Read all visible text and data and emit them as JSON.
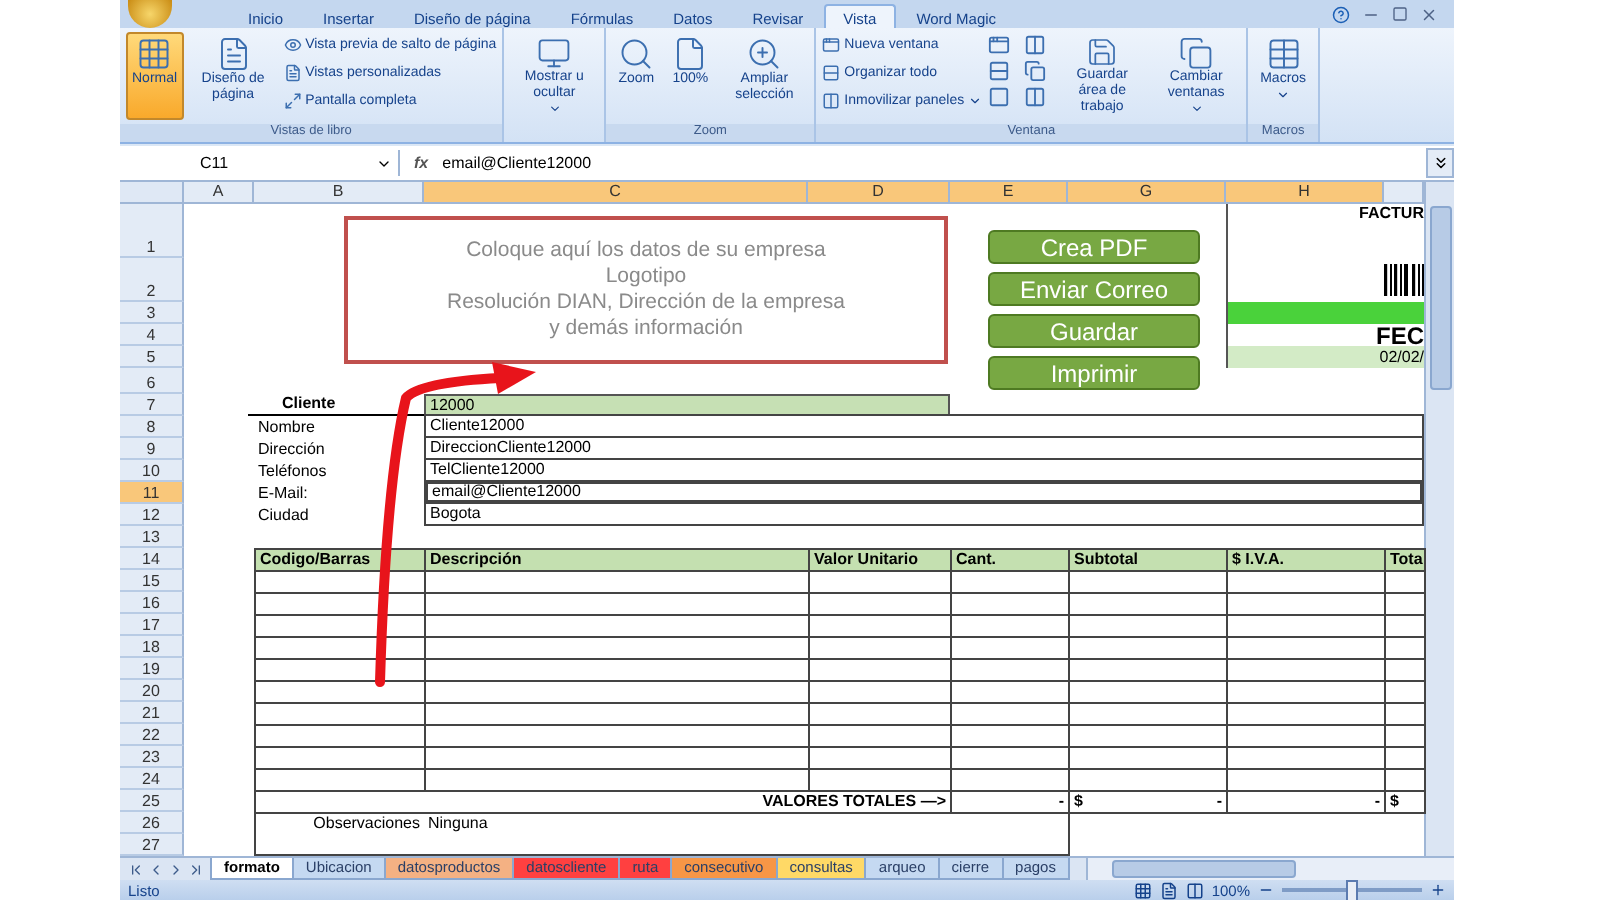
{
  "ribbon_tabs": [
    {
      "label": "Inicio",
      "selected": false
    },
    {
      "label": "Insertar",
      "selected": false
    },
    {
      "label": "Diseño de página",
      "selected": false
    },
    {
      "label": "Fórmulas",
      "selected": false
    },
    {
      "label": "Datos",
      "selected": false
    },
    {
      "label": "Revisar",
      "selected": false
    },
    {
      "label": "Vista",
      "selected": true
    },
    {
      "label": "Word Magic",
      "selected": false
    }
  ],
  "ribbon_groups": [
    {
      "label": "Vistas de libro",
      "items": [
        {
          "kind": "large",
          "label": "Normal",
          "selected": true,
          "dropdown": false
        },
        {
          "kind": "large",
          "label": "Diseño de página",
          "selected": false,
          "dropdown": false
        },
        {
          "kind": "small",
          "labels": [
            "Vista previa de salto de página",
            "Vistas personalizadas",
            "Pantalla completa"
          ]
        }
      ]
    },
    {
      "items": [
        {
          "kind": "large",
          "label": "Mostrar u ocultar",
          "selected": false,
          "dropdown": true
        }
      ]
    },
    {
      "label": "Zoom",
      "items": [
        {
          "kind": "large",
          "label": "Zoom",
          "selected": false,
          "dropdown": false
        },
        {
          "kind": "large",
          "label": "100%",
          "selected": false,
          "dropdown": false
        },
        {
          "kind": "large",
          "label": "Ampliar selección",
          "selected": false,
          "dropdown": false
        }
      ]
    },
    {
      "label": "Ventana",
      "items": [
        {
          "kind": "small",
          "labels": [
            "Nueva ventana",
            "Organizar todo",
            "Inmovilizar paneles"
          ],
          "dropdown_last": true
        },
        {
          "kind": "icon_grid"
        },
        {
          "kind": "large",
          "label": "Guardar área de trabajo",
          "selected": false,
          "dropdown": false
        },
        {
          "kind": "large",
          "label": "Cambiar ventanas",
          "selected": false,
          "dropdown": true
        }
      ]
    },
    {
      "label": "Macros",
      "items": [
        {
          "kind": "large",
          "label": "Macros",
          "selected": false,
          "dropdown": true
        }
      ]
    }
  ],
  "formula_bar": {
    "name_box": "C11",
    "fx_label": "fx",
    "value": "email@Cliente12000"
  },
  "columns": [
    {
      "label": "A",
      "selected": false
    },
    {
      "label": "B",
      "selected": false
    },
    {
      "label": "C",
      "selected": true
    },
    {
      "label": "D",
      "selected": true
    },
    {
      "label": "E",
      "selected": true
    },
    {
      "label": "G",
      "selected": true
    },
    {
      "label": "H",
      "selected": true
    }
  ],
  "rows": [
    {
      "label": "1",
      "selected": false
    },
    {
      "label": "2",
      "selected": false
    },
    {
      "label": "3",
      "selected": false
    },
    {
      "label": "4",
      "selected": false
    },
    {
      "label": "5",
      "selected": false
    },
    {
      "label": "6",
      "selected": false
    },
    {
      "label": "7",
      "selected": false
    },
    {
      "label": "8",
      "selected": false
    },
    {
      "label": "9",
      "selected": false
    },
    {
      "label": "10",
      "selected": false
    },
    {
      "label": "11",
      "selected": true
    },
    {
      "label": "12",
      "selected": false
    },
    {
      "label": "13",
      "selected": false
    },
    {
      "label": "14",
      "selected": false
    },
    {
      "label": "15",
      "selected": false
    },
    {
      "label": "16",
      "selected": false
    },
    {
      "label": "17",
      "selected": false
    },
    {
      "label": "18",
      "selected": false
    },
    {
      "label": "19",
      "selected": false
    },
    {
      "label": "20",
      "selected": false
    },
    {
      "label": "21",
      "selected": false
    },
    {
      "label": "22",
      "selected": false
    },
    {
      "label": "23",
      "selected": false
    },
    {
      "label": "24",
      "selected": false
    },
    {
      "label": "25",
      "selected": false
    },
    {
      "label": "26",
      "selected": false
    },
    {
      "label": "27",
      "selected": false
    }
  ],
  "company_box": {
    "lines": [
      "Coloque aquí los datos de su empresa",
      "Logotipo",
      "Resolución DIAN, Dirección de la empresa",
      "y demás información"
    ]
  },
  "action_buttons": [
    "Crea PDF",
    "Enviar Correo",
    "Guardar",
    "Imprimir"
  ],
  "invoice_header": {
    "title": "FACTUR",
    "date_label": "FEC",
    "date": "02/02/"
  },
  "client": {
    "label": "Cliente",
    "value": "12000",
    "fields": [
      {
        "label": "Nombre",
        "value": "Cliente12000"
      },
      {
        "label": "Dirección",
        "value": "DireccionCliente12000"
      },
      {
        "label": "Teléfonos",
        "value": "TelCliente12000"
      },
      {
        "label": "E-Mail:",
        "value": "email@Cliente12000"
      },
      {
        "label": "Ciudad",
        "value": "Bogota"
      }
    ]
  },
  "table": {
    "columns": [
      "Codigo/Barras",
      "Descripción",
      "Valor Unitario",
      "Cant.",
      "Subtotal",
      "$ I.V.A.",
      "Tota"
    ],
    "totals": {
      "label": "VALORES TOTALES —>",
      "cells": [
        {
          "text": "-"
        },
        {
          "currency": "$",
          "text": "-"
        },
        {
          "text": "-"
        },
        {
          "currency": "$"
        }
      ]
    }
  },
  "observations": {
    "label": "Observaciones",
    "value": "Ninguna"
  },
  "sheet_tabs": [
    {
      "label": "formato",
      "selected": true,
      "color": "#ffffff"
    },
    {
      "label": "Ubicacion",
      "selected": false,
      "color": "#c5d9f1"
    },
    {
      "label": "datosproductos",
      "selected": false,
      "color": "#f4b183"
    },
    {
      "label": "datoscliente",
      "selected": false,
      "color": "#ff4040"
    },
    {
      "label": "ruta",
      "selected": false,
      "color": "#ff4040"
    },
    {
      "label": "consecutivo",
      "selected": false,
      "color": "#f79646"
    },
    {
      "label": "consultas",
      "selected": false,
      "color": "#ffd966"
    },
    {
      "label": "arqueo",
      "selected": false,
      "color": "#c5d9f1"
    },
    {
      "label": "cierre",
      "selected": false,
      "color": "#c5d9f1"
    },
    {
      "label": "pagos",
      "selected": false,
      "color": "#c5d9f1"
    }
  ],
  "status_bar": {
    "text": "Listo",
    "zoom": {
      "label": "100%",
      "level": 0.5
    }
  }
}
